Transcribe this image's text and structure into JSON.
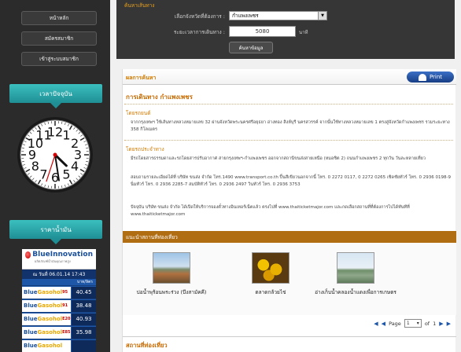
{
  "sidebar": {
    "nav": [
      {
        "label": "หน้าหลัก"
      },
      {
        "label": "สมัครสมาชิก"
      },
      {
        "label": "เข้าสู่ระบบสมาชิก"
      }
    ],
    "clock_title": "เวลาปัจจุบัน",
    "clock": {
      "hour": 4,
      "minute": 28,
      "second": 33
    },
    "oil_title": "ราคาน้ำมัน",
    "oil": {
      "brand": "BlueInnovation",
      "brand_sub": "ผลิตภัณฑ์น้ำมันคุณภาพสูง",
      "date": "ณ วันที่ 06.01.14 17:43",
      "unit": "บาท/ลิตร",
      "prices": [
        {
          "name_a": "Blue",
          "name_b": "Gasohol",
          "suffix": "95",
          "value": "40.45"
        },
        {
          "name_a": "Blue",
          "name_b": "Gasohol",
          "suffix": "91",
          "value": "38.48"
        },
        {
          "name_a": "Blue",
          "name_b": "Gasohol",
          "suffix": "E20",
          "value": "40.93"
        },
        {
          "name_a": "Blue",
          "name_b": "Gasohol",
          "suffix": "E85",
          "value": "35.98"
        },
        {
          "name_a": "Blue",
          "name_b": "Gasohol",
          "suffix": "",
          "value": ""
        }
      ]
    }
  },
  "search": {
    "title": "ค้นหาเส้นทาง",
    "province_label": "เลือกจังหวัดที่ต้องการ :",
    "province_value": "กำแพงเพชร",
    "time_label": "ระยะเวลาการเดินทาง :",
    "time_value": "5080",
    "time_unit": "นาที",
    "button": "ค้นหาข้อมูล"
  },
  "result": {
    "bar_title": "ผลการค้นหา",
    "print": "Print",
    "route_title": "การเดินทาง กำแพงเพชร",
    "car_title": "โดยรถยนต์",
    "car_text": "จากกรุงเทพฯ ใช้เส้นทางหลวงหมายเลข 32 ผ่านจังหวัดพระนครศรีอยุธยา อ่างทอง สิงห์บุรี นครสวรรค์ จากนั้นใช้ทางหลวงหมายเลข 1 ตรงสู่จังหวัดกำแพงเพชร รวมระยะทาง 358 กิโลเมตร",
    "bus_title": "โดยรถประจำทาง",
    "bus_text_1": "มีรถโดยสารธรรมดาและรถโดยสารปรับอากาศ สายกรุงเทพฯ-กำแพงเพชร ออกจากสถานีขนส่งสายเหนือ (หมอชิต 2) ถนนกำแพงเพชร 2 ทุกวัน วันละหลายเที่ยว",
    "bus_text_2": "สอบถามรายละเอียดได้ที่ บริษัท ขนส่ง จำกัด โทร.1490 www.transport.co.th ปิ้นสีเขียวนอกจากนี้ โทร. 0 2272 0117, 0 2272 0265 เชิดชัยทัวร์ โทร. 0 2936 0198-9 นิ่มทัวร์ โทร. 0 2936 2285-7 สมบัติทัวร์ โทร. 0 2936 2497 วินทัวร์ โทร. 0 2936 3753",
    "bus_text_3": "ปัจจุบัน บริษัท ขนส่ง จำกัด ได้เปิดให้บริการจองตั๋วทางอินเทอร์เน็ตแล้ว ตรงไปที่ www.thaiticketmajor.com และกดเลือกสถานที่ที่ต้องการไปได้ทันทีที่ www.thaiticketmajor.com",
    "places_title": "แนะนำสถานที่ท่องเที่ยว",
    "places": [
      {
        "caption": "บ่อน้ำพุร้อนพระร่วง (บึงสามัคคี)"
      },
      {
        "caption": "ตลาดกล้วยไข่"
      },
      {
        "caption": "อ่างเก็บน้ำคลองน้ำแดงเพื่อการเกษตร"
      }
    ],
    "pager": {
      "first": "◀",
      "prev": "◀",
      "label": "Page",
      "value": "1",
      "of": "of",
      "total": "1",
      "next": "▶",
      "last": "▶"
    },
    "stats_title": "สถานที่ท่องเที่ยว"
  },
  "colors": {
    "accent_orange": "#c86a00",
    "teal": "#1f8f95",
    "oil_blue": "#1e56a8",
    "dark_panel": "#363636"
  }
}
